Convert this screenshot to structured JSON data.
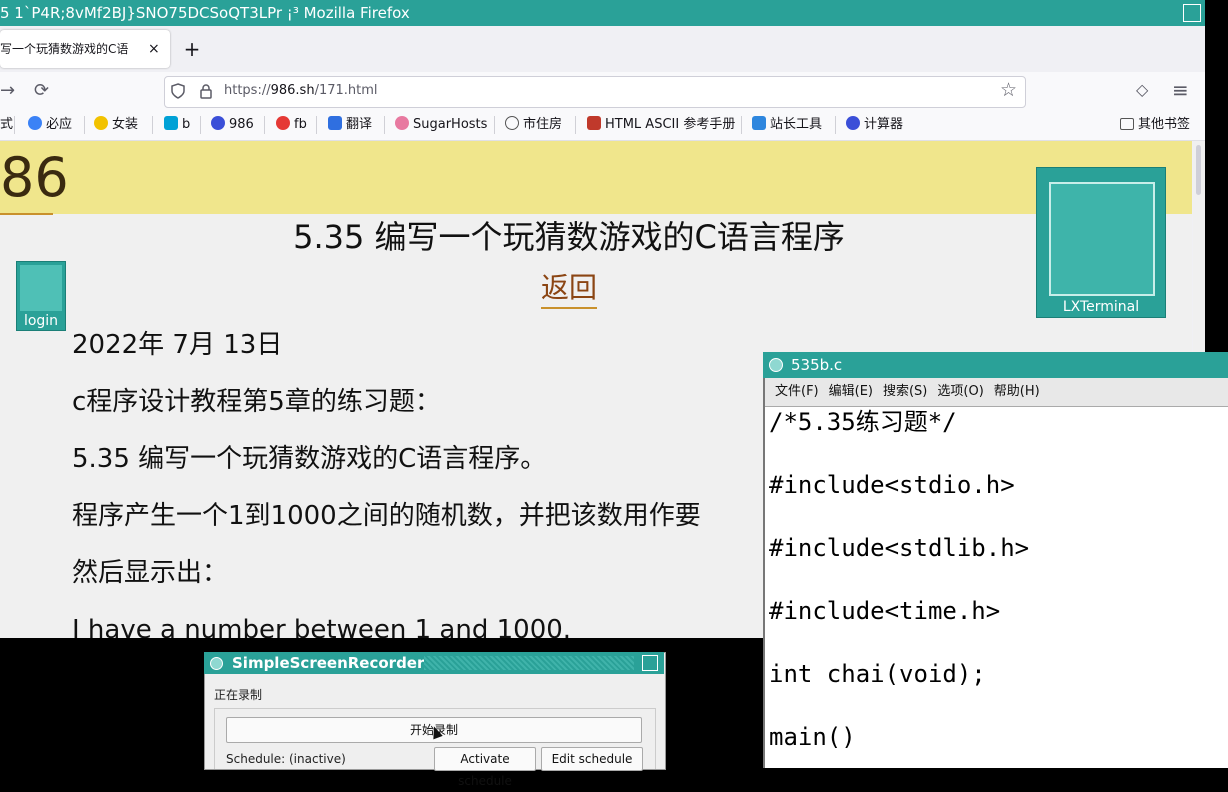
{
  "firefox": {
    "window_title": "5 1`P4R;8vMf2BJ}SNO75DCSoQT3LPr ¡³ Mozilla Firefox",
    "tab_title": "写一个玩猜数游戏的C语",
    "tab_close": "×",
    "new_tab": "+",
    "back_icon": "→",
    "reload_icon": "⟳",
    "url_prefix": "https://",
    "url_domain": "986.sh",
    "url_path": "/171.html",
    "bookmark_star": "☆",
    "pocket_icon": "◇",
    "menu_icon": "≡"
  },
  "bookmarks": [
    {
      "label": "式",
      "color": "#777777"
    },
    {
      "label": "必应",
      "color": "#3b82f6"
    },
    {
      "label": "女装",
      "color": "#f2c200"
    },
    {
      "label": "b",
      "color": "#00a1d6"
    },
    {
      "label": "986",
      "color": "#3b4fd8"
    },
    {
      "label": "fb",
      "color": "#e53935"
    },
    {
      "label": "翻译",
      "color": "#2f6fe0"
    },
    {
      "label": "SugarHosts",
      "color": "#e879a0"
    },
    {
      "label": "市住房",
      "color": "#555555"
    },
    {
      "label": "HTML ASCII 参考手册",
      "color": "#c0392b"
    },
    {
      "label": "站长工具",
      "color": "#2e86de"
    },
    {
      "label": "计算器",
      "color": "#3b4fd8"
    }
  ],
  "other_bookmarks": "其他书签",
  "page": {
    "logo": "86",
    "title": "5.35 编写一个玩猜数游戏的C语言程序",
    "back": "返回",
    "login": "login",
    "date": "2022年 7月 13日",
    "p1": "c程序设计教程第5章的练习题：",
    "p2": "5.35 编写一个玩猜数游戏的C语言程序。",
    "p3": "程序产生一个1到1000之间的随机数，并把该数用作要",
    "p4": "然后显示出：",
    "p5": "I have a number between 1 and 1000."
  },
  "desktop": {
    "lxterminal": "LXTerminal"
  },
  "editor": {
    "title": "535b.c",
    "menu": [
      "文件(F)",
      "编辑(E)",
      "搜索(S)",
      "选项(O)",
      "帮助(H)"
    ],
    "lines": [
      "/*5.35练习题*/",
      "",
      "#include<stdio.h>",
      "",
      "#include<stdlib.h>",
      "",
      "#include<time.h>",
      "",
      "int chai(void);",
      "",
      "main()"
    ]
  },
  "recorder": {
    "title": "SimpleScreenRecorder",
    "status": "正在录制",
    "start": "开始录制",
    "schedule": "Schedule: (inactive)",
    "activate": "Activate schedule",
    "edit": "Edit schedule"
  },
  "colors": {
    "title_bar": "#2aa198",
    "banner": "#f0e68c",
    "link": "#8b4513"
  }
}
